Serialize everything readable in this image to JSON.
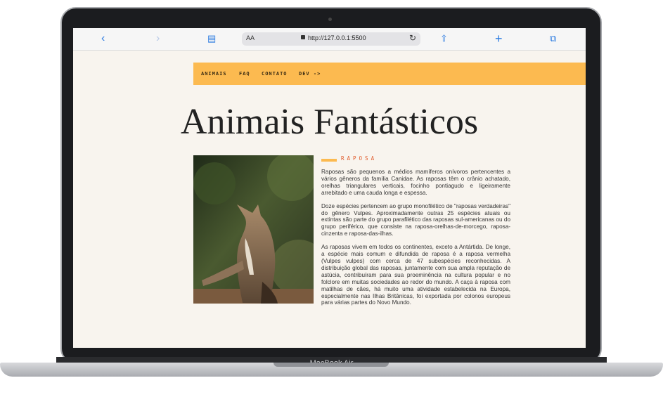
{
  "device": {
    "label": "MacBook Air"
  },
  "browser": {
    "text_size_label": "AA",
    "url": "http://127.0.0.1:5500",
    "icons": [
      "back-icon",
      "forward-icon",
      "book-icon",
      "lock-icon",
      "reload-icon",
      "share-icon",
      "new-tab-icon",
      "tabs-icon"
    ]
  },
  "nav": {
    "items": [
      "ANIMAIS",
      "FAQ",
      "CONTATO",
      "DEV ->"
    ]
  },
  "page": {
    "title": "Animais Fantásticos",
    "section": {
      "label": "RAPOSA",
      "paragraphs": [
        "Raposas são pequenos a médios mamíferos onívoros pertencentes a vários gêneros da família Canidae. As raposas têm o crânio achatado, orelhas triangulares verticais, focinho pontiagudo e ligeiramente arrebitado e uma cauda longa e espessa.",
        "Doze espécies pertencem ao grupo monofilético de \"raposas verdadeiras\" do gênero Vulpes. Aproximadamente outras 25 espécies atuais ou extintas são parte do grupo parafilético das raposas sul-americanas ou do grupo periférico, que consiste na raposa-orelhas-de-morcego, raposa-cinzenta e raposa-das-ilhas.",
        "As raposas vivem em todos os continentes, exceto a Antártida. De longe, a espécie mais comum e difundida de raposa é a raposa vermelha (Vulpes vulpes) com cerca de 47 subespécies reconhecidas. A distribuição global das raposas, juntamente com sua ampla reputação de astúcia, contribuíram para sua proeminência na cultura popular e no folclore em muitas sociedades ao redor do mundo. A caça à raposa com matilhas de cães, há muito uma atividade estabelecida na Europa, especialmente nas Ilhas Britânicas, foi exportada por colonos europeus para várias partes do Novo Mundo."
      ]
    }
  },
  "colors": {
    "accent": "#fcba50",
    "label": "#e05a2a",
    "background": "#f8f4ee"
  }
}
